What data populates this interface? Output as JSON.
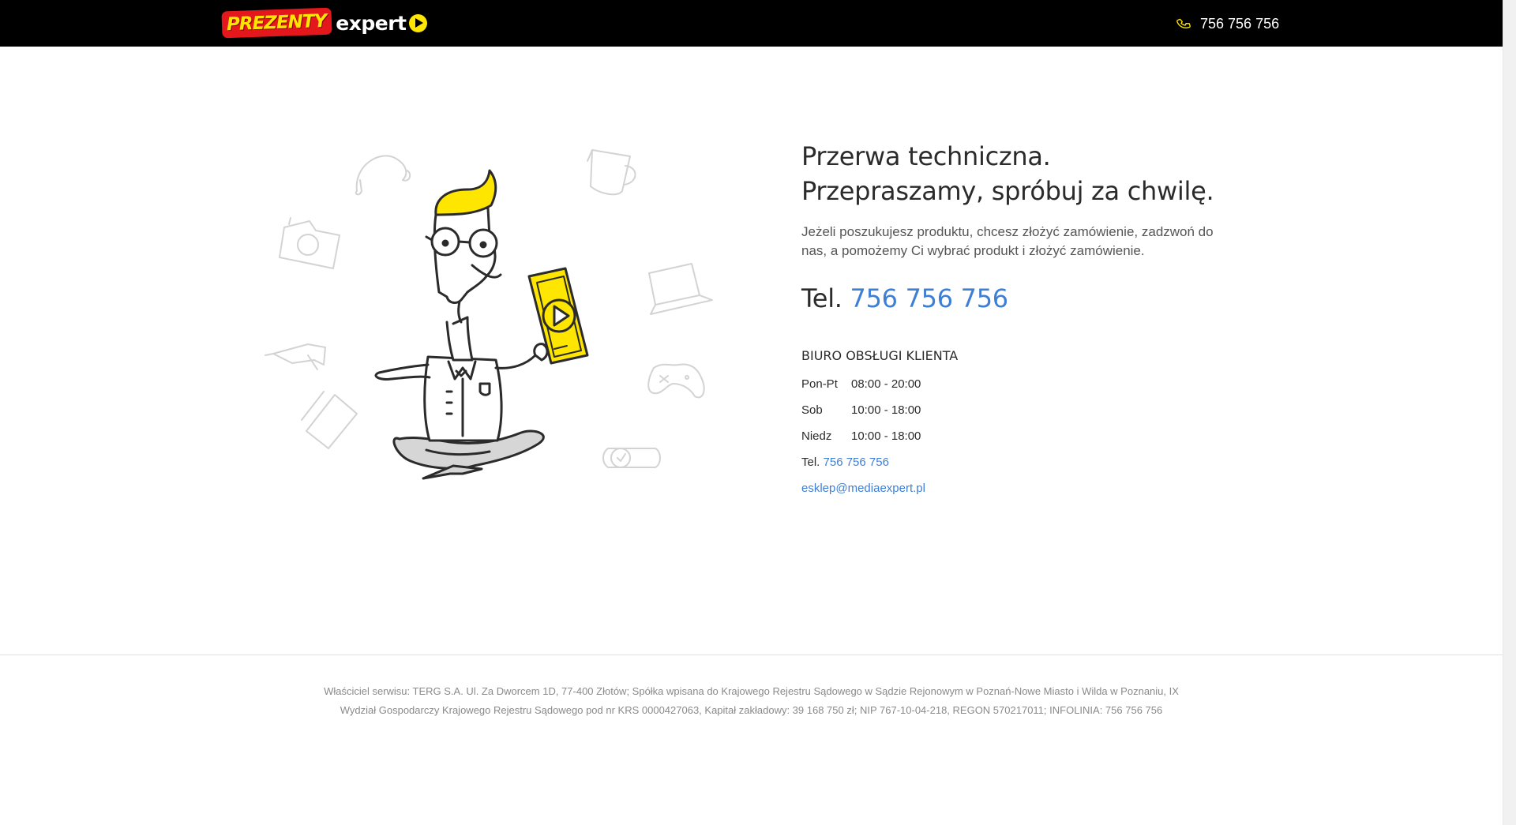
{
  "header": {
    "logo_badge": "PREZENTY",
    "logo_word": "expert",
    "phone": "756 756 756"
  },
  "main": {
    "heading_line1": "Przerwa techniczna.",
    "heading_line2": "Przepraszamy, spróbuj za chwilę.",
    "lead": "Jeżeli poszukujesz produktu, chcesz złożyć zamówienie, zadzwoń do nas, a pomożemy Ci wybrać produkt i złożyć zamówienie.",
    "tel_prefix": "Tel.",
    "tel_number": "756 756 756"
  },
  "office": {
    "title": "BIURO OBSŁUGI KLIENTA",
    "hours": [
      {
        "day": "Pon-Pt",
        "time": "08:00 - 20:00"
      },
      {
        "day": "Sob",
        "time": "10:00 - 18:00"
      },
      {
        "day": "Niedz",
        "time": "10:00 - 18:00"
      }
    ],
    "tel_prefix": "Tel.",
    "tel_number": "756 756 756",
    "email": "esklep@mediaexpert.pl"
  },
  "footer": {
    "line1": "Właściciel serwisu: TERG S.A. Ul. Za Dworcem 1D, 77-400 Złotów; Spółka wpisana do Krajowego Rejestru Sądowego w Sądzie Rejonowym w Poznań-Nowe Miasto i Wilda w Poznaniu, IX",
    "line2": "Wydział Gospodarczy Krajowego Rejestru Sądowego pod nr KRS 0000427063, Kapitał zakładowy: 39 168 750 zł; NIP 767-10-04-218, REGON 570217011; INFOLINIA: 756 756 756"
  },
  "colors": {
    "header_bg": "#000000",
    "accent_yellow": "#ffe600",
    "brand_red": "#e4181c",
    "link_blue": "#3e7fd6"
  },
  "icons": [
    "phone-icon",
    "play-icon",
    "headphones-icon",
    "mug-icon",
    "camera-icon",
    "laptop-icon",
    "hairdryer-icon",
    "gamepad-icon",
    "tablet-icon",
    "watch-icon"
  ]
}
